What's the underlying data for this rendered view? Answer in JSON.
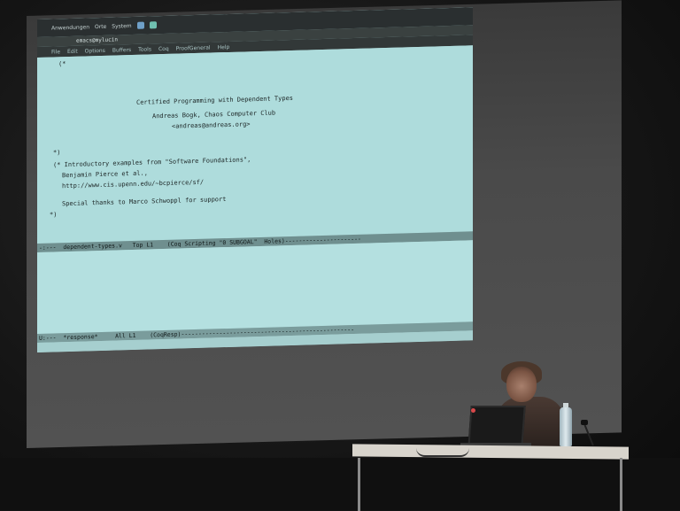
{
  "panel": {
    "app_name": "Anwendungen",
    "menu_places": "Orte",
    "menu_system": "System"
  },
  "window": {
    "title": "emacs@mylucin"
  },
  "menu": {
    "items": [
      "File",
      "Edit",
      "Options",
      "Buffers",
      "Tools",
      "Coq",
      "ProofGeneral",
      "Help"
    ]
  },
  "editor": {
    "lines": [
      "(*",
      "Certified Programming with Dependent Types",
      "Andreas Bogk, Chaos Computer Club",
      "<andreas@andreas.org>",
      "*)",
      "(* Introductory examples from \"Software Foundations\",",
      "Benjamin Pierce et al.,",
      "http://www.cis.upenn.edu/~bcpierce/sf/",
      "Special thanks to Marco Schwoppl for support",
      "*)"
    ]
  },
  "mode_line": {
    "text": "-:---  dependent-types.v   Top L1    (Coq Scripting \"0 SUBGOAL\"  Holes)----------------------"
  },
  "response_mode_line": {
    "text": "U:---  *response*     All L1    (CoqResp)--------------------------------------------------"
  },
  "colors": {
    "screen_bg": "#aedcdc",
    "mode_line": "#6f8f8f",
    "room": "#141414"
  }
}
